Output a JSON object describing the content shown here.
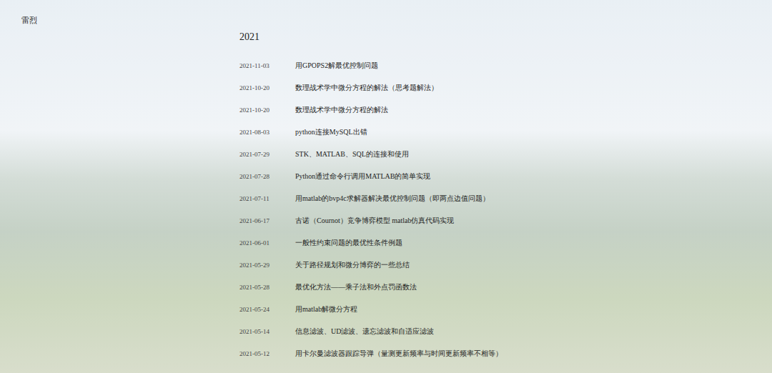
{
  "site": {
    "author": "雷烈"
  },
  "archive": {
    "year": "2021",
    "posts": [
      {
        "date": "2021-11-03",
        "title": "用GPOPS2解最优控制问题"
      },
      {
        "date": "2021-10-20",
        "title": "数理战术学中微分方程的解法（思考题解法）"
      },
      {
        "date": "2021-10-20",
        "title": "数理战术学中微分方程的解法"
      },
      {
        "date": "2021-08-03",
        "title": "python连接MySQL出错"
      },
      {
        "date": "2021-07-29",
        "title": "STK、MATLAB、SQL的连接和使用"
      },
      {
        "date": "2021-07-28",
        "title": "Python通过命令行调用MATLAB的简单实现"
      },
      {
        "date": "2021-07-11",
        "title": "用matlab的bvp4c求解器解决最优控制问题（即两点边值问题）"
      },
      {
        "date": "2021-06-17",
        "title": "古诺（Cournot）竞争博弈模型 matlab仿真代码实现"
      },
      {
        "date": "2021-06-01",
        "title": "一般性约束问题的最优性条件例题"
      },
      {
        "date": "2021-05-29",
        "title": "关于路径规划和微分博弈的一些总结"
      },
      {
        "date": "2021-05-28",
        "title": "最优化方法——乘子法和外点罚函数法"
      },
      {
        "date": "2021-05-24",
        "title": "用matlab解微分方程"
      },
      {
        "date": "2021-05-14",
        "title": "信息滤波、UD滤波、遗忘滤波和自适应滤波"
      },
      {
        "date": "2021-05-12",
        "title": "用卡尔曼滤波器跟踪导弹（量测更新频率与时间更新频率不相等）"
      }
    ]
  }
}
